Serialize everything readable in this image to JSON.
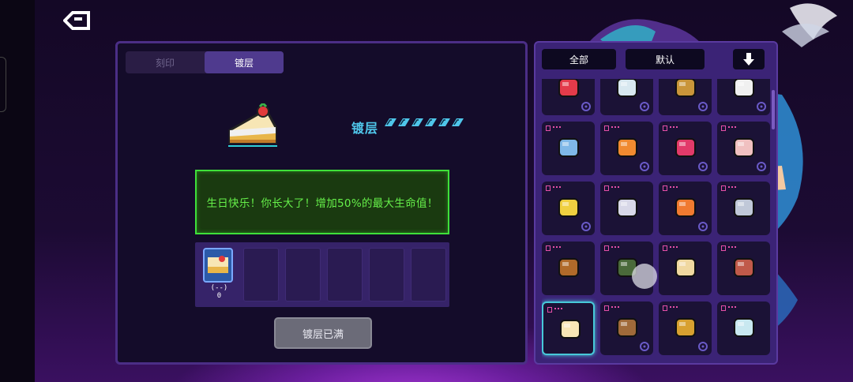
{
  "tabs": [
    {
      "label": "刻印",
      "active": false
    },
    {
      "label": "镀层",
      "active": true
    }
  ],
  "detail": {
    "plating_label": "镀层",
    "plating_level_filled": 6,
    "plating_level_total": 6,
    "description": "生日快乐！你长大了！增加50%的最大生命值！",
    "slot_caption_line1": "(--)",
    "slot_caption_line2": "0",
    "empty_slots": 5,
    "full_button": "镀层已满"
  },
  "inventory": {
    "filter_all": "全部",
    "sort_default": "默认",
    "items": [
      {
        "icon": "red-orb-charm-icon",
        "sub": "moon-icon"
      },
      {
        "icon": "card-box-icon",
        "sub": "orbit-icon"
      },
      {
        "icon": "treasure-chest-icon",
        "sub": "gear-icon"
      },
      {
        "icon": "skull-icon",
        "sub": "gear-icon"
      },
      {
        "icon": "syringe-icon",
        "sub": ""
      },
      {
        "icon": "flame-torch-icon",
        "sub": "anchor-icon"
      },
      {
        "icon": "mouth-icon",
        "sub": "swirl-icon"
      },
      {
        "icon": "scroll-icon",
        "sub": "sparkle-icon"
      },
      {
        "icon": "battery-icon",
        "sub": "orbit-icon"
      },
      {
        "icon": "target-icon",
        "sub": ""
      },
      {
        "icon": "carrot-bundle-icon",
        "sub": "sparkle-icon"
      },
      {
        "icon": "shorts-icon",
        "sub": ""
      },
      {
        "icon": "acorn-icon",
        "sub": ""
      },
      {
        "icon": "cloak-icon",
        "sub": ""
      },
      {
        "icon": "bandage-icon",
        "sub": ""
      },
      {
        "icon": "cake-block-icon",
        "sub": ""
      },
      {
        "icon": "cake-slice-icon",
        "sub": "",
        "selected": true
      },
      {
        "icon": "coin-bag-icon",
        "sub": "anchor-icon"
      },
      {
        "icon": "golden-mask-icon",
        "sub": "cup-icon"
      },
      {
        "icon": "robot-head-icon",
        "sub": ""
      }
    ]
  },
  "colors": {
    "accent_cyan": "#4fc6ea",
    "desc_green": "#66f04a",
    "panel_purple": "#3b2376",
    "tag_pink": "#e44fa8"
  }
}
